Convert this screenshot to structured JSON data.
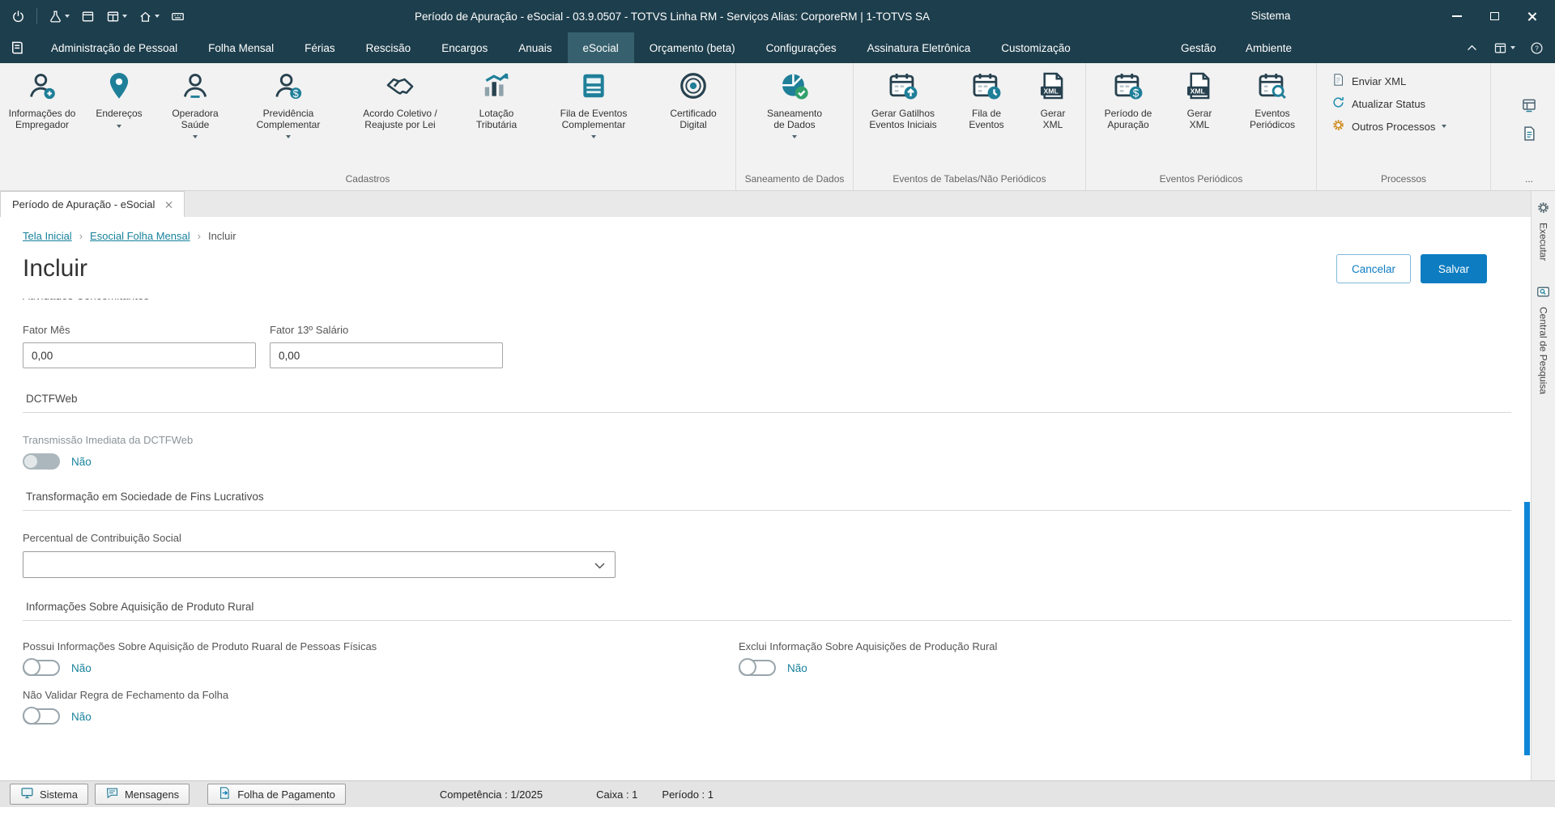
{
  "colors": {
    "header_bg": "#1d3e4c",
    "accent_teal": "#17829c",
    "save_button": "#0d7cc1",
    "scrollbar_thumb": "#0d86d8"
  },
  "titlebar": {
    "title": "Período de Apuração - eSocial - 03.9.0507 - TOTVS Linha RM - Serviços  Alias: CorporeRM | 1-TOTVS SA",
    "context_tab": "Sistema"
  },
  "menubar": {
    "items": [
      "Administração de Pessoal",
      "Folha Mensal",
      "Férias",
      "Rescisão",
      "Encargos",
      "Anuais",
      "eSocial",
      "Orçamento (beta)",
      "Configurações",
      "Assinatura Eletrônica",
      "Customização",
      "Gestão",
      "Ambiente"
    ],
    "active_item": "eSocial"
  },
  "ribbon": {
    "groups": [
      {
        "label": "Cadastros",
        "items": [
          {
            "label": "Informações do Empregador",
            "dropdown": false,
            "icon": "person-badge-icon"
          },
          {
            "label": "Endereços",
            "dropdown": true,
            "icon": "map-pin-icon"
          },
          {
            "label": "Operadora Saúde",
            "dropdown": true,
            "icon": "person-icon"
          },
          {
            "label": "Previdência Complementar",
            "dropdown": true,
            "icon": "person-dollar-icon"
          },
          {
            "label": "Acordo Coletivo / Reajuste por Lei",
            "dropdown": false,
            "icon": "handshake-icon"
          },
          {
            "label": "Lotação Tributária",
            "dropdown": false,
            "icon": "bar-chart-icon"
          },
          {
            "label": "Fila de Eventos Complementar",
            "dropdown": true,
            "icon": "panel-list-icon"
          },
          {
            "label": "Certificado Digital",
            "dropdown": false,
            "icon": "target-icon"
          }
        ]
      },
      {
        "label": "Saneamento de Dados",
        "items": [
          {
            "label": "Saneamento de Dados",
            "dropdown": true,
            "icon": "pie-check-icon"
          }
        ]
      },
      {
        "label": "Eventos de Tabelas/Não Periódicos",
        "items": [
          {
            "label": "Gerar Gatilhos Eventos Iniciais",
            "dropdown": false,
            "icon": "calendar-upload-icon"
          },
          {
            "label": "Fila de Eventos",
            "dropdown": false,
            "icon": "calendar-clock-icon"
          },
          {
            "label": "Gerar XML",
            "dropdown": false,
            "icon": "xml-document-icon"
          }
        ]
      },
      {
        "label": "Eventos Periódicos",
        "items": [
          {
            "label": "Período de Apuração",
            "dropdown": false,
            "icon": "calendar-money-icon"
          },
          {
            "label": "Gerar XML",
            "dropdown": false,
            "icon": "xml-document-icon"
          },
          {
            "label": "Eventos Periódicos",
            "dropdown": false,
            "icon": "calendar-search-icon"
          }
        ]
      },
      {
        "label": "Processos",
        "items": [
          {
            "label": "Enviar XML",
            "dropdown": false,
            "icon": "document-send-icon"
          },
          {
            "label": "Atualizar Status",
            "dropdown": false,
            "icon": "refresh-icon"
          },
          {
            "label": "Outros Processos",
            "dropdown": true,
            "icon": "gear-icon"
          }
        ]
      }
    ],
    "more_label": "..."
  },
  "document_tab": {
    "label": "Período de Apuração - eSocial"
  },
  "breadcrumb": {
    "items": [
      "Tela Inicial",
      "Esocial Folha Mensal",
      "Incluir"
    ],
    "separator": "›"
  },
  "page": {
    "title": "Incluir",
    "cancel_button": "Cancelar",
    "save_button": "Salvar"
  },
  "form": {
    "clipped_section": "Atividades Concomitantes",
    "fator_mes": {
      "label": "Fator Mês",
      "value": "0,00"
    },
    "fator_13": {
      "label": "Fator 13º Salário",
      "value": "0,00"
    },
    "section_dctfweb": "DCTFWeb",
    "transmissao": {
      "label": "Transmissão Imediata da DCTFWeb",
      "value": "Não"
    },
    "section_transformacao": "Transformação em Sociedade de Fins Lucrativos",
    "percentual": {
      "label": "Percentual de Contribuição Social",
      "value": ""
    },
    "section_aquisicao": "Informações Sobre Aquisição de Produto Rural",
    "possui_info": {
      "label": "Possui Informações Sobre Aquisição de Produto Ruaral de Pessoas Físicas",
      "value": "Não"
    },
    "exclui_info": {
      "label": "Exclui Informação Sobre Aquisições de Produção Rural",
      "value": "Não"
    },
    "nao_validar": {
      "label": "Não Validar Regra de Fechamento da Folha",
      "value": "Não"
    }
  },
  "right_sidebar": {
    "items": [
      "Executar",
      "Central de Pesquisa"
    ]
  },
  "statusbar": {
    "buttons": [
      "Sistema",
      "Mensagens",
      "Folha de Pagamento"
    ],
    "info": [
      "Competência : 1/2025",
      "Caixa : 1",
      "Período : 1"
    ]
  }
}
